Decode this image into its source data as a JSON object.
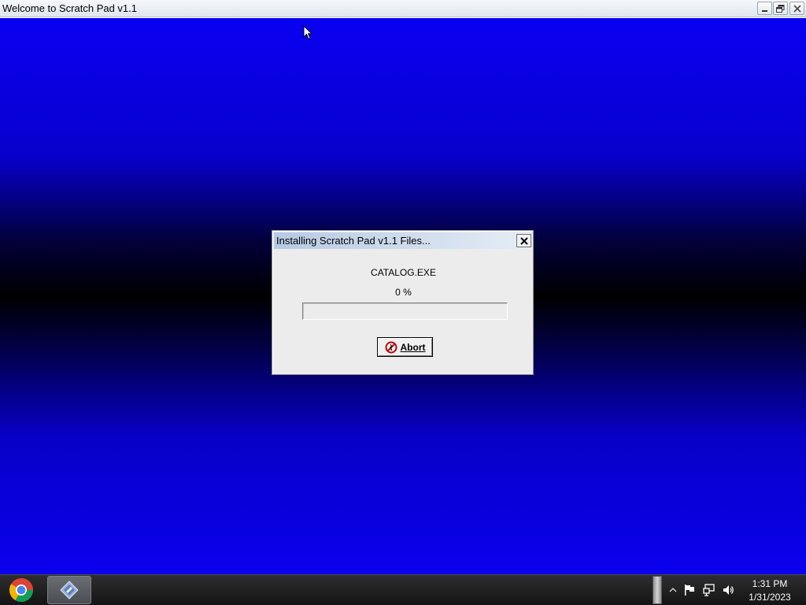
{
  "main_window": {
    "title": "Welcome to Scratch Pad v1.1",
    "controls": {
      "minimize_icon": "minimize-icon",
      "maximize_icon": "restore-icon",
      "close_icon": "close-icon"
    }
  },
  "dialog": {
    "title": "Installing Scratch Pad v1.1 Files...",
    "current_file": "CATALOG.EXE",
    "percent_text": "0 %",
    "progress": 0,
    "abort_label": "Abort",
    "abort_icon": "stop-icon"
  },
  "taskbar": {
    "start_icon": "chrome-icon",
    "pinned_app_icon": "app-diamond-icon",
    "tray": {
      "icons": [
        "show-hidden-icons-arrow",
        "action-center-flag-icon",
        "network-icon",
        "volume-icon"
      ]
    },
    "clock": {
      "time": "1:31 PM",
      "date": "1/31/2023"
    }
  },
  "colors": {
    "desktop_blue": "#0a00f2",
    "desktop_dark": "#000000",
    "dialog_bg": "#ececec",
    "taskbar_bg": "#1e1e1e"
  }
}
